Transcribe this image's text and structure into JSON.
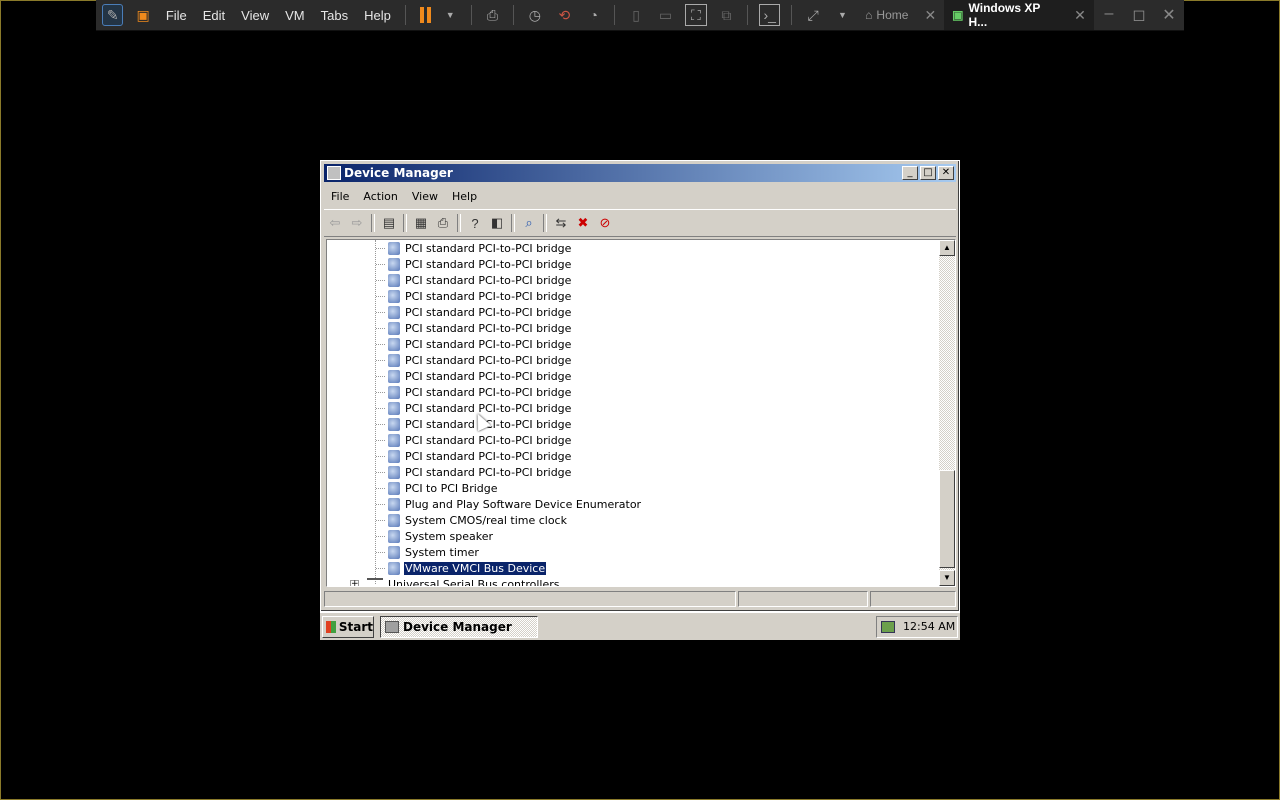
{
  "host": {
    "menu": [
      "File",
      "Edit",
      "View",
      "VM",
      "Tabs",
      "Help"
    ],
    "tabs": [
      {
        "label": "Home",
        "active": false
      },
      {
        "label": "Windows XP H...",
        "active": true
      }
    ],
    "accent": "#f08a1c"
  },
  "window": {
    "title": "Device Manager",
    "menu": [
      "File",
      "Action",
      "View",
      "Help"
    ]
  },
  "tree": {
    "devices": [
      "PCI standard PCI-to-PCI bridge",
      "PCI standard PCI-to-PCI bridge",
      "PCI standard PCI-to-PCI bridge",
      "PCI standard PCI-to-PCI bridge",
      "PCI standard PCI-to-PCI bridge",
      "PCI standard PCI-to-PCI bridge",
      "PCI standard PCI-to-PCI bridge",
      "PCI standard PCI-to-PCI bridge",
      "PCI standard PCI-to-PCI bridge",
      "PCI standard PCI-to-PCI bridge",
      "PCI standard PCI-to-PCI bridge",
      "PCI standard PCI-to-PCI bridge",
      "PCI standard PCI-to-PCI bridge",
      "PCI standard PCI-to-PCI bridge",
      "PCI standard PCI-to-PCI bridge",
      "PCI to PCI Bridge",
      "Plug and Play Software Device Enumerator",
      "System CMOS/real time clock",
      "System speaker",
      "System timer",
      "VMware VMCI Bus Device"
    ],
    "selected_index": 20,
    "next_category": "Universal Serial Bus controllers"
  },
  "taskbar": {
    "start_label": "Start",
    "task_label": "Device Manager",
    "clock": "12:54 AM"
  }
}
